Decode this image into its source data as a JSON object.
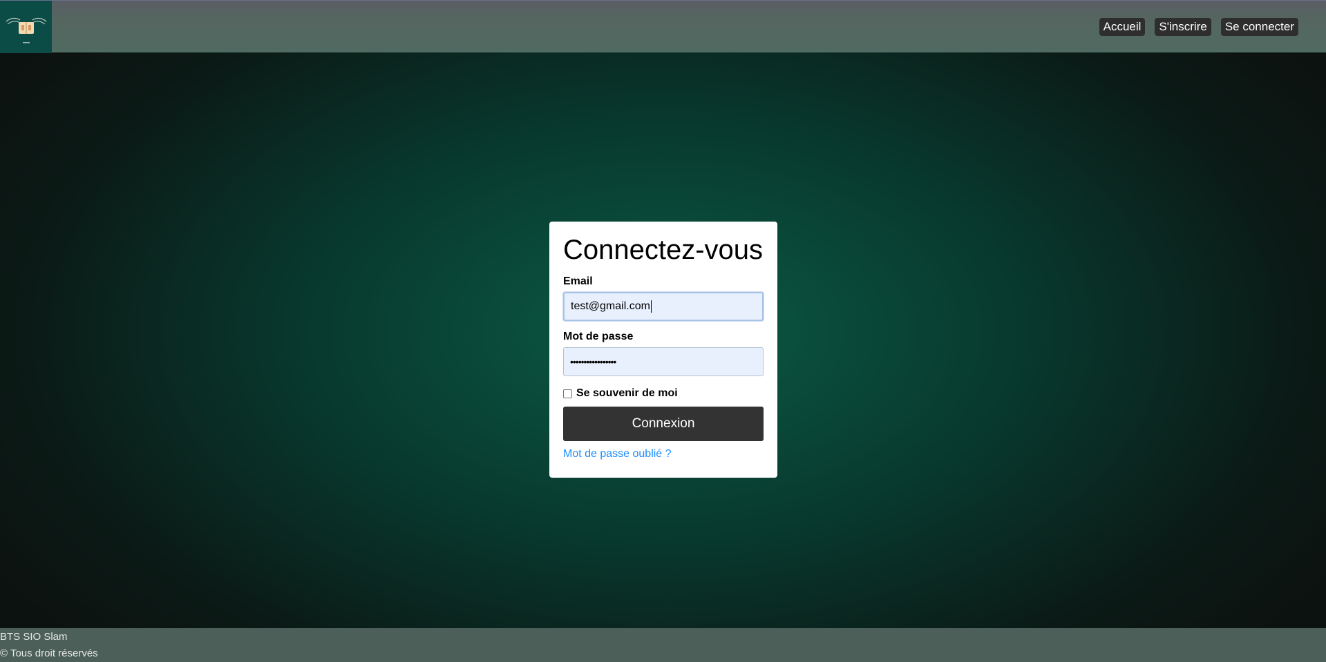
{
  "header": {
    "logo_icon": "book-with-wings-logo",
    "nav": [
      {
        "label": "Accueil"
      },
      {
        "label": "S'inscrire"
      },
      {
        "label": "Se connecter"
      }
    ]
  },
  "login": {
    "title": "Connectez-vous",
    "email_label": "Email",
    "email_value": "test@gmail.com",
    "password_label": "Mot de passe",
    "password_value": "•••••••••••••••••",
    "remember_label": "Se souvenir de moi",
    "remember_checked": false,
    "submit_label": "Connexion",
    "forgot_link": "Mot de passe oublié ?"
  },
  "footer": {
    "line1": "BTS SIO Slam",
    "line2": "© Tous droit réservés"
  },
  "colors": {
    "accent_link": "#1a8cff",
    "button_dark": "#333333",
    "input_bg": "#e8effd"
  }
}
